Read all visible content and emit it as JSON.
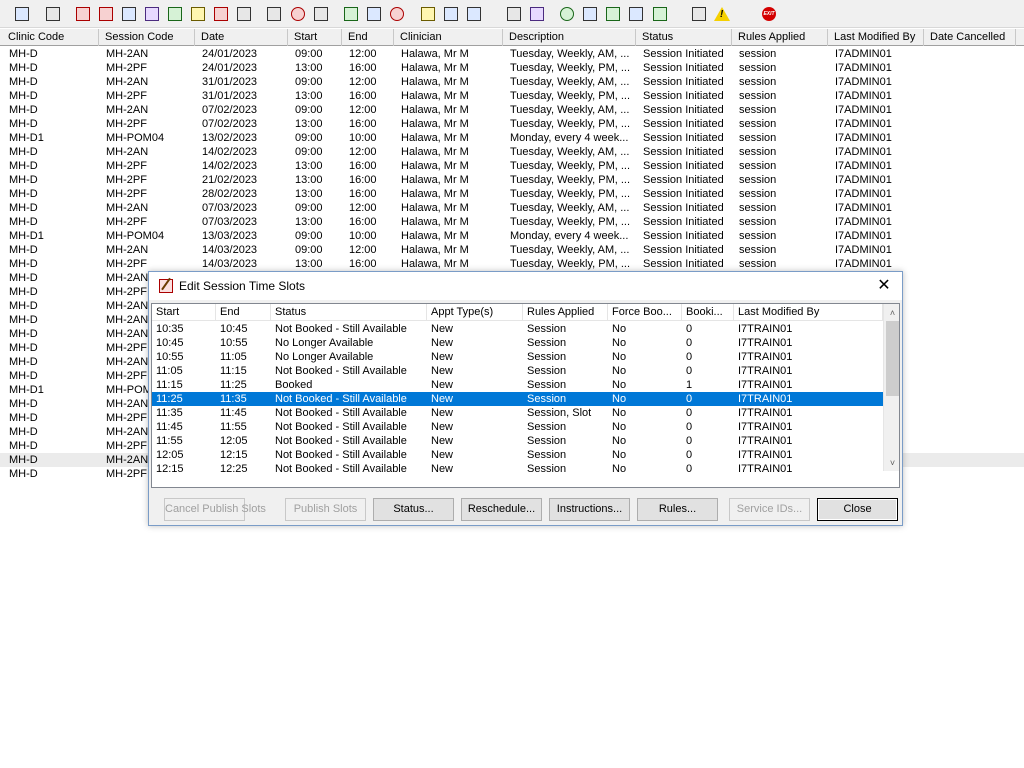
{
  "toolbar": {
    "icons": [
      "user-search-icon",
      "print-icon",
      "book-icon",
      "edit-book-icon",
      "calendar-icon",
      "memo-icon",
      "person-icon",
      "notepad-icon",
      "flag-icon",
      "flag-list-icon",
      "tools-icon",
      "clock-icon",
      "window-icon",
      "report-icon",
      "form-icon",
      "target-icon",
      "notes-icon",
      "transfer-icon",
      "people-icon",
      "document-icon",
      "bar-chart-icon",
      "globe-icon",
      "check-list-icon",
      "check-icon",
      "down-arrow-icon",
      "tick-arrow-icon",
      "swap-icon",
      "warning-icon",
      "exit-icon"
    ]
  },
  "grid": {
    "columns": [
      "Clinic Code",
      "Session Code",
      "Date",
      "Start",
      "End",
      "Clinician",
      "Description",
      "Status",
      "Rules Applied",
      "Last Modified By",
      "Date Cancelled"
    ],
    "rows": [
      [
        "MH-D",
        "MH-2AN",
        "24/01/2023",
        "09:00",
        "12:00",
        "Halawa, Mr M",
        "Tuesday, Weekly, AM, ...",
        "Session Initiated",
        "session",
        "I7ADMIN01",
        ""
      ],
      [
        "MH-D",
        "MH-2PF",
        "24/01/2023",
        "13:00",
        "16:00",
        "Halawa, Mr M",
        "Tuesday, Weekly, PM, ...",
        "Session Initiated",
        "session",
        "I7ADMIN01",
        ""
      ],
      [
        "MH-D",
        "MH-2AN",
        "31/01/2023",
        "09:00",
        "12:00",
        "Halawa, Mr M",
        "Tuesday, Weekly, AM, ...",
        "Session Initiated",
        "session",
        "I7ADMIN01",
        ""
      ],
      [
        "MH-D",
        "MH-2PF",
        "31/01/2023",
        "13:00",
        "16:00",
        "Halawa, Mr M",
        "Tuesday, Weekly, PM, ...",
        "Session Initiated",
        "session",
        "I7ADMIN01",
        ""
      ],
      [
        "MH-D",
        "MH-2AN",
        "07/02/2023",
        "09:00",
        "12:00",
        "Halawa, Mr M",
        "Tuesday, Weekly, AM, ...",
        "Session Initiated",
        "session",
        "I7ADMIN01",
        ""
      ],
      [
        "MH-D",
        "MH-2PF",
        "07/02/2023",
        "13:00",
        "16:00",
        "Halawa, Mr M",
        "Tuesday, Weekly, PM, ...",
        "Session Initiated",
        "session",
        "I7ADMIN01",
        ""
      ],
      [
        "MH-D1",
        "MH-POM04",
        "13/02/2023",
        "09:00",
        "10:00",
        "Halawa, Mr M",
        "Monday, every 4 week...",
        "Session Initiated",
        "session",
        "I7ADMIN01",
        ""
      ],
      [
        "MH-D",
        "MH-2AN",
        "14/02/2023",
        "09:00",
        "12:00",
        "Halawa, Mr M",
        "Tuesday, Weekly, AM, ...",
        "Session Initiated",
        "session",
        "I7ADMIN01",
        ""
      ],
      [
        "MH-D",
        "MH-2PF",
        "14/02/2023",
        "13:00",
        "16:00",
        "Halawa, Mr M",
        "Tuesday, Weekly, PM, ...",
        "Session Initiated",
        "session",
        "I7ADMIN01",
        ""
      ],
      [
        "MH-D",
        "MH-2PF",
        "21/02/2023",
        "13:00",
        "16:00",
        "Halawa, Mr M",
        "Tuesday, Weekly, PM, ...",
        "Session Initiated",
        "session",
        "I7ADMIN01",
        ""
      ],
      [
        "MH-D",
        "MH-2PF",
        "28/02/2023",
        "13:00",
        "16:00",
        "Halawa, Mr M",
        "Tuesday, Weekly, PM, ...",
        "Session Initiated",
        "session",
        "I7ADMIN01",
        ""
      ],
      [
        "MH-D",
        "MH-2AN",
        "07/03/2023",
        "09:00",
        "12:00",
        "Halawa, Mr M",
        "Tuesday, Weekly, AM, ...",
        "Session Initiated",
        "session",
        "I7ADMIN01",
        ""
      ],
      [
        "MH-D",
        "MH-2PF",
        "07/03/2023",
        "13:00",
        "16:00",
        "Halawa, Mr M",
        "Tuesday, Weekly, PM, ...",
        "Session Initiated",
        "session",
        "I7ADMIN01",
        ""
      ],
      [
        "MH-D1",
        "MH-POM04",
        "13/03/2023",
        "09:00",
        "10:00",
        "Halawa, Mr M",
        "Monday, every 4 week...",
        "Session Initiated",
        "session",
        "I7ADMIN01",
        ""
      ],
      [
        "MH-D",
        "MH-2AN",
        "14/03/2023",
        "09:00",
        "12:00",
        "Halawa, Mr M",
        "Tuesday, Weekly, AM, ...",
        "Session Initiated",
        "session",
        "I7ADMIN01",
        ""
      ],
      [
        "MH-D",
        "MH-2PF",
        "14/03/2023",
        "13:00",
        "16:00",
        "Halawa, Mr M",
        "Tuesday, Weekly, PM, ...",
        "Session Initiated",
        "session",
        "I7ADMIN01",
        ""
      ],
      [
        "MH-D",
        "MH-2AN",
        "",
        "",
        "",
        "",
        "",
        "",
        "",
        "",
        ""
      ],
      [
        "MH-D",
        "MH-2PF",
        "",
        "",
        "",
        "",
        "",
        "",
        "",
        "",
        ""
      ],
      [
        "MH-D",
        "MH-2AN",
        "",
        "",
        "",
        "",
        "",
        "",
        "",
        "",
        ""
      ],
      [
        "MH-D",
        "MH-2AN",
        "",
        "",
        "",
        "",
        "",
        "",
        "",
        "",
        ""
      ],
      [
        "MH-D",
        "MH-2AN",
        "",
        "",
        "",
        "",
        "",
        "",
        "",
        "",
        ""
      ],
      [
        "MH-D",
        "MH-2PF",
        "",
        "",
        "",
        "",
        "",
        "",
        "",
        "",
        ""
      ],
      [
        "MH-D",
        "MH-2AN",
        "",
        "",
        "",
        "",
        "",
        "",
        "",
        "",
        ""
      ],
      [
        "MH-D",
        "MH-2PF",
        "",
        "",
        "",
        "",
        "",
        "",
        "",
        "",
        ""
      ],
      [
        "MH-D1",
        "MH-POM",
        "",
        "",
        "",
        "",
        "",
        "",
        "",
        "",
        ""
      ],
      [
        "MH-D",
        "MH-2AN",
        "",
        "",
        "",
        "",
        "",
        "",
        "",
        "",
        ""
      ],
      [
        "MH-D",
        "MH-2PF",
        "",
        "",
        "",
        "",
        "",
        "",
        "",
        "",
        ""
      ],
      [
        "MH-D",
        "MH-2AN",
        "",
        "",
        "",
        "",
        "",
        "",
        "",
        "",
        ""
      ],
      [
        "MH-D",
        "MH-2PF",
        "",
        "",
        "",
        "",
        "",
        "",
        "",
        "",
        ""
      ],
      [
        "MH-D",
        "MH-2AN",
        "",
        "",
        "",
        "",
        "",
        "",
        "",
        "",
        ""
      ],
      [
        "MH-D",
        "MH-2PF",
        "",
        "",
        "",
        "",
        "",
        "",
        "",
        "",
        ""
      ]
    ],
    "highlighted_row": 29
  },
  "dialog": {
    "title": "Edit Session Time Slots",
    "close_glyph": "✕",
    "columns": [
      "Start",
      "End",
      "Status",
      "Appt Type(s)",
      "Rules Applied",
      "Force Boo...",
      "Booki...",
      "Last Modified By"
    ],
    "selected_row": 5,
    "rows": [
      [
        "10:35",
        "10:45",
        "Not Booked - Still Available",
        "New",
        "Session",
        "No",
        "0",
        "I7TRAIN01"
      ],
      [
        "10:45",
        "10:55",
        "No Longer Available",
        "New",
        "Session",
        "No",
        "0",
        "I7TRAIN01"
      ],
      [
        "10:55",
        "11:05",
        "No Longer Available",
        "New",
        "Session",
        "No",
        "0",
        "I7TRAIN01"
      ],
      [
        "11:05",
        "11:15",
        "Not Booked - Still Available",
        "New",
        "Session",
        "No",
        "0",
        "I7TRAIN01"
      ],
      [
        "11:15",
        "11:25",
        "Booked",
        "New",
        "Session",
        "No",
        "1",
        "I7TRAIN01"
      ],
      [
        "11:25",
        "11:35",
        "Not Booked - Still Available",
        "New",
        "Session",
        "No",
        "0",
        "I7TRAIN01"
      ],
      [
        "11:35",
        "11:45",
        "Not Booked - Still Available",
        "New",
        "Session, Slot",
        "No",
        "0",
        "I7TRAIN01"
      ],
      [
        "11:45",
        "11:55",
        "Not Booked - Still Available",
        "New",
        "Session",
        "No",
        "0",
        "I7TRAIN01"
      ],
      [
        "11:55",
        "12:05",
        "Not Booked - Still Available",
        "New",
        "Session",
        "No",
        "0",
        "I7TRAIN01"
      ],
      [
        "12:05",
        "12:15",
        "Not Booked - Still Available",
        "New",
        "Session",
        "No",
        "0",
        "I7TRAIN01"
      ],
      [
        "12:15",
        "12:25",
        "Not Booked - Still Available",
        "New",
        "Session",
        "No",
        "0",
        "I7TRAIN01"
      ]
    ],
    "buttons": {
      "cancel_publish": "Cancel Publish Slots",
      "publish": "Publish Slots",
      "status": "Status...",
      "reschedule": "Reschedule...",
      "instructions": "Instructions...",
      "rules": "Rules...",
      "service_ids": "Service IDs...",
      "close": "Close"
    },
    "scroll": {
      "up": "˄",
      "down": "˅",
      "left": "<",
      "right": ">"
    }
  }
}
